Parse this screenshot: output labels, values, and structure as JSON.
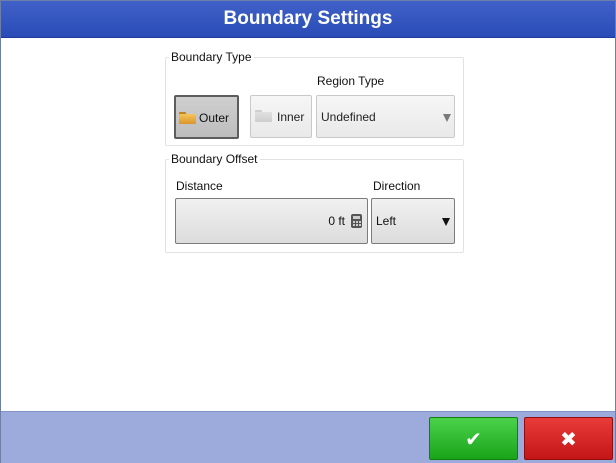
{
  "window": {
    "title": "Boundary Settings"
  },
  "boundary_type": {
    "label": "Boundary Type",
    "outer_label": "Outer",
    "inner_label": "Inner",
    "selected": "Outer",
    "region_type": {
      "label": "Region Type",
      "value": "Undefined"
    }
  },
  "boundary_offset": {
    "label": "Boundary Offset",
    "distance": {
      "label": "Distance",
      "value": "0 ft"
    },
    "direction": {
      "label": "Direction",
      "value": "Left"
    }
  },
  "footer": {
    "ok_glyph": "✔",
    "cancel_glyph": "✖"
  },
  "icons": [
    "folder-icon",
    "folder-icon",
    "chevron-down-icon",
    "calculator-icon",
    "chevron-down-icon",
    "checkmark-icon",
    "close-icon"
  ],
  "colors": {
    "title_bar": "#2f52bd",
    "footer": "#9cabdc",
    "ok": "#22b022",
    "cancel": "#d42020"
  }
}
